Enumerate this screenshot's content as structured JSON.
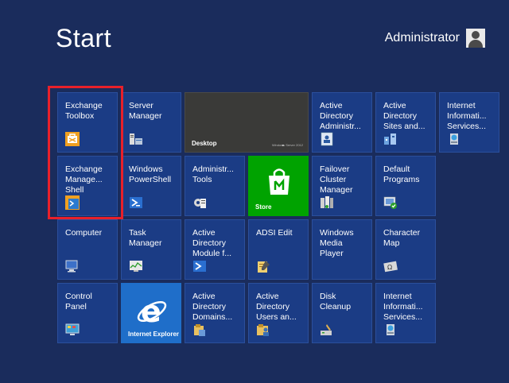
{
  "header": {
    "title": "Start",
    "user_name": "Administrator"
  },
  "tiles": {
    "exchange_toolbox": "Exchange\nToolbox",
    "server_manager": "Server\nManager",
    "desktop": "Desktop",
    "desktop_watermark": "Windows Server 2012",
    "ad_admin": "Active\nDirectory\nAdministr...",
    "ad_sites": "Active\nDirectory\nSites and...",
    "iis1": "Internet\nInformati...\nServices...",
    "exchange_shell": "Exchange\nManage...\nShell",
    "powershell": "Windows\nPowerShell",
    "admin_tools": "Administr...\nTools",
    "store": "Store",
    "failover": "Failover\nCluster\nManager",
    "default_programs": "Default\nPrograms",
    "computer": "Computer",
    "task_manager": "Task\nManager",
    "ad_module": "Active\nDirectory\nModule f...",
    "adsi_edit": "ADSI Edit",
    "media_player": "Windows\nMedia\nPlayer",
    "char_map": "Character\nMap",
    "control_panel": "Control\nPanel",
    "ie": "Internet Explorer",
    "ad_domains": "Active\nDirectory\nDomains...",
    "ad_users": "Active\nDirectory\nUsers an...",
    "disk_cleanup": "Disk\nCleanup",
    "iis2": "Internet\nInformati...\nServices..."
  },
  "colors": {
    "background": "#1a2c5c",
    "tile": "#1b3c85",
    "store": "#00a300",
    "ie": "#1f6ec9",
    "highlight": "#e8202a"
  }
}
